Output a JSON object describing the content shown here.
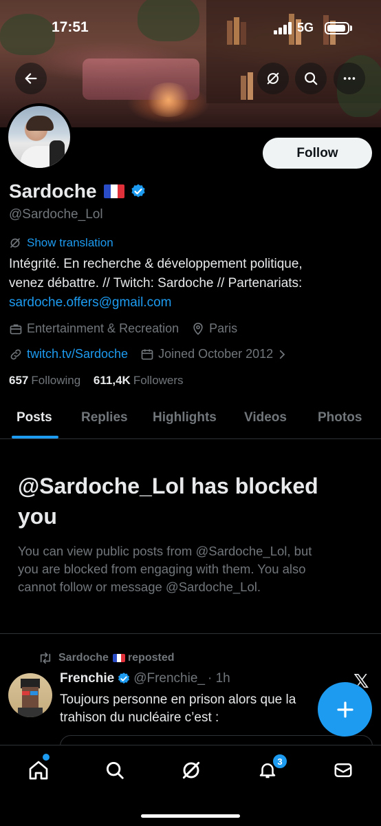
{
  "status_bar": {
    "time": "17:51",
    "network": "5G"
  },
  "profile": {
    "name": "Sardoche",
    "handle": "@Sardoche_Lol",
    "follow_label": "Follow",
    "show_translation": "Show translation",
    "bio_lines": [
      "Intégrité. En recherche & développement politique,",
      "venez débattre. // Twitch: Sardoche // Partenariats:"
    ],
    "bio_email": "sardoche.offers@gmail.com",
    "category": "Entertainment & Recreation",
    "location": "Paris",
    "website": "twitch.tv/Sardoche",
    "joined": "Joined October 2012",
    "following_count": "657",
    "following_label": "Following",
    "followers_count": "611,4K",
    "followers_label": "Followers"
  },
  "tabs": [
    {
      "label": "Posts",
      "active": true
    },
    {
      "label": "Replies",
      "active": false
    },
    {
      "label": "Highlights",
      "active": false
    },
    {
      "label": "Videos",
      "active": false
    },
    {
      "label": "Photos",
      "active": false
    }
  ],
  "blocked": {
    "title_lines": [
      "@Sardoche_Lol has blocked",
      "you"
    ],
    "message_lines": [
      "You can view public posts from @Sardoche_Lol, but",
      "you are blocked from engaging with them. You also",
      "cannot follow or message @Sardoche_Lol."
    ]
  },
  "post": {
    "repost_by": "Sardoche",
    "repost_label": "reposted",
    "author_name": "Frenchie",
    "author_handle": "@Frenchie_",
    "time": "· 1h",
    "text_lines": [
      "Toujours personne en prison alors que la",
      "trahison du nucléaire c’est :"
    ]
  },
  "notifications_badge": "3",
  "colors": {
    "accent": "#1d9bf0",
    "background": "#000000",
    "secondary_text": "#71767b"
  },
  "icons": [
    "back-arrow-icon",
    "translate-icon",
    "search-icon",
    "more-icon",
    "briefcase-icon",
    "location-pin-icon",
    "link-icon",
    "calendar-icon",
    "chevron-right-icon",
    "repost-icon",
    "verified-icon",
    "x-logo-icon",
    "plus-icon",
    "home-icon",
    "grok-icon",
    "bell-icon",
    "mail-icon"
  ]
}
